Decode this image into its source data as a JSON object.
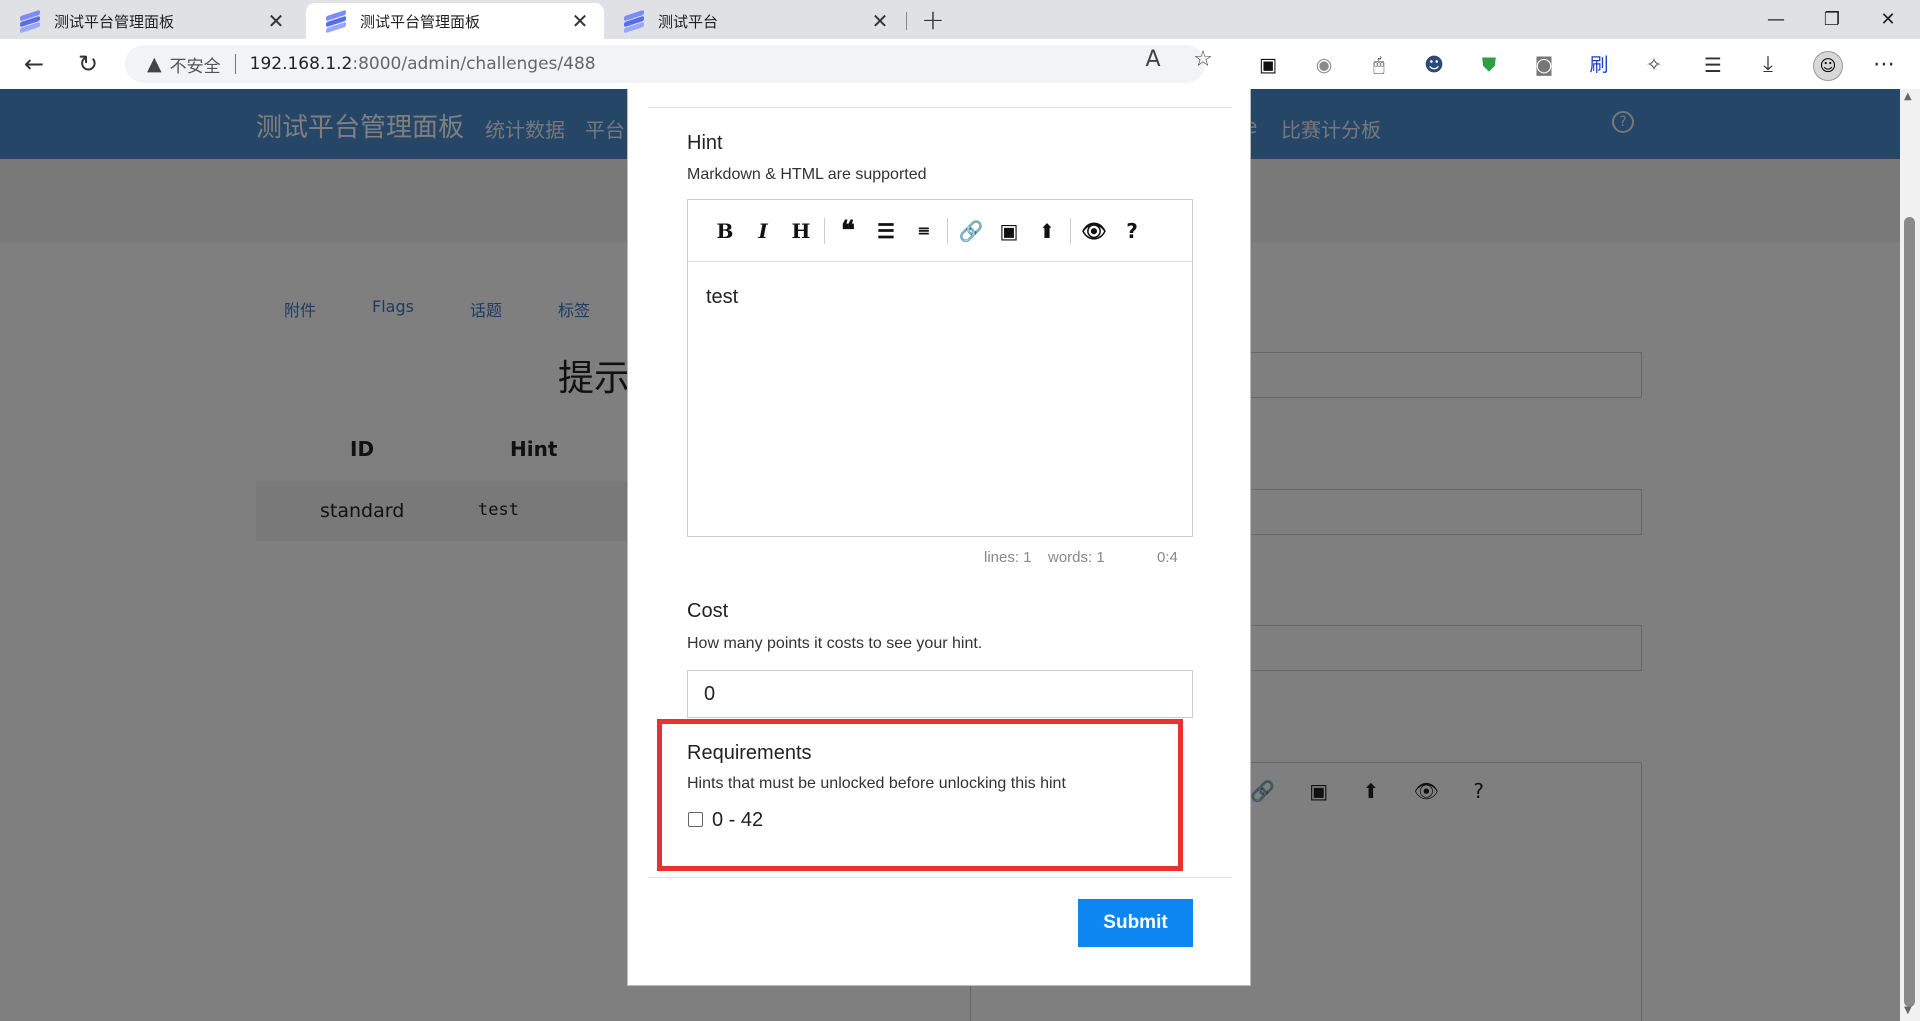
{
  "browser": {
    "tabs": [
      {
        "title": "测试平台管理面板",
        "close": "✕"
      },
      {
        "title": "测试平台管理面板",
        "close": "✕"
      },
      {
        "title": "测试平台",
        "close": "✕"
      }
    ],
    "new_tab": "+",
    "address": {
      "security_label": "不安全",
      "host": "192.168.1.2",
      "path": ":8000/admin/challenges/488"
    },
    "extensions": [
      {
        "icon": "translator-icon",
        "glyph": "▣",
        "color": "#111111"
      },
      {
        "icon": "circle-icon",
        "glyph": "◉",
        "color": "#8a8a8a"
      },
      {
        "icon": "mouse-icon",
        "glyph": "🖱",
        "color": "#333333"
      },
      {
        "icon": "ninja-icon",
        "glyph": "☻",
        "color": "#2a4a7a"
      },
      {
        "icon": "shield-icon",
        "glyph": "⛊",
        "color": "#2e9e46"
      },
      {
        "icon": "camera-icon",
        "glyph": "◙",
        "color": "#777777"
      },
      {
        "icon": "brush-icon",
        "glyph": "刷",
        "color": "#1a3ec9"
      },
      {
        "icon": "puzzle-icon",
        "glyph": "✧",
        "color": "#444444"
      }
    ]
  },
  "background_page": {
    "brand": "测试平台管理面板",
    "nav": [
      "统计数据",
      "平台",
      "e",
      "比赛计分板"
    ],
    "tabs": [
      "附件",
      "Flags",
      "话题",
      "标签"
    ],
    "title": "提示",
    "table": {
      "headers": [
        "ID",
        "Hint"
      ],
      "row": [
        "standard",
        "test"
      ]
    }
  },
  "modal": {
    "hint_label": "Hint",
    "hint_help": "Markdown & HTML are supported",
    "editor_content": "test",
    "status": {
      "lines": "lines: 1",
      "words": "words: 1",
      "cursor": "0:4"
    },
    "cost_label": "Cost",
    "cost_help": "How many points it costs to see your hint.",
    "cost_value": "0",
    "requirements_label": "Requirements",
    "requirements_help": "Hints that must be unlocked before unlocking this hint",
    "requirement_option": "0 - 42",
    "submit": "Submit"
  }
}
